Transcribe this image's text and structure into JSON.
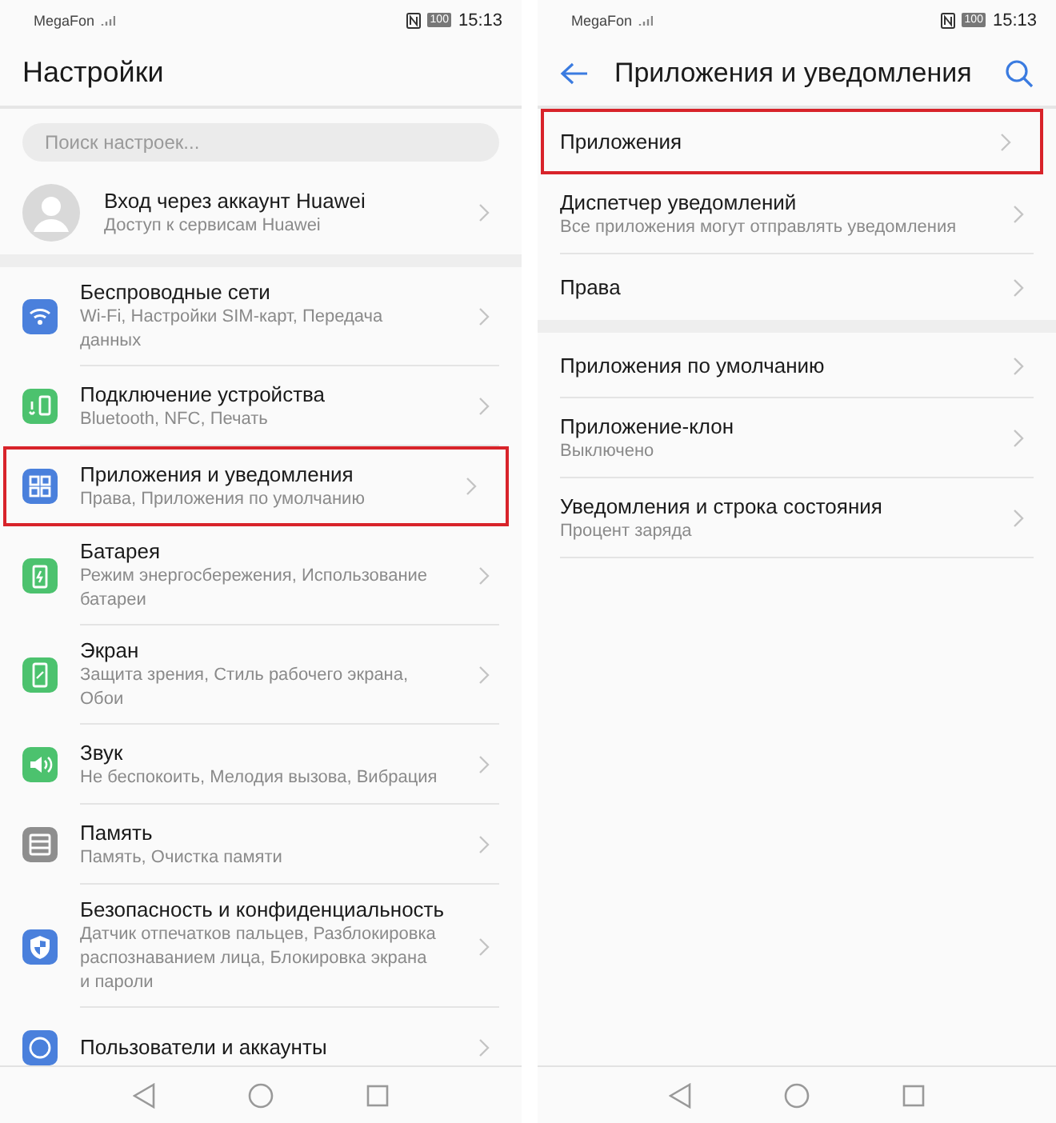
{
  "settings_screen": {
    "status_bar": {
      "carrier": "MegaFon",
      "battery": "100",
      "time": "15:13"
    },
    "header": {
      "title": "Настройки"
    },
    "search": {
      "placeholder": "Поиск настроек..."
    },
    "account": {
      "title": "Вход через аккаунт Huawei",
      "subtitle": "Доступ к сервисам Huawei"
    },
    "items": [
      {
        "title": "Беспроводные сети",
        "subtitle": "Wi-Fi, Настройки SIM-карт, Передача данных",
        "color": "#4a80dc",
        "highlighted": false
      },
      {
        "title": "Подключение устройства",
        "subtitle": "Bluetooth, NFC, Печать",
        "color": "#4cc26e",
        "highlighted": false
      },
      {
        "title": "Приложения и уведомления",
        "subtitle": "Права, Приложения по умолчанию",
        "color": "#4a80dc",
        "highlighted": true
      },
      {
        "title": "Батарея",
        "subtitle": "Режим энергосбережения, Использование батареи",
        "color": "#4cc26e",
        "highlighted": false
      },
      {
        "title": "Экран",
        "subtitle": "Защита зрения, Стиль рабочего экрана, Обои",
        "color": "#4cc26e",
        "highlighted": false
      },
      {
        "title": "Звук",
        "subtitle": "Не беспокоить, Мелодия вызова, Вибрация",
        "color": "#4cc26e",
        "highlighted": false
      },
      {
        "title": "Память",
        "subtitle": "Память, Очистка памяти",
        "color": "#8e8e8e",
        "highlighted": false
      },
      {
        "title": "Безопасность и конфиденциальность",
        "subtitle": "Датчик отпечатков пальцев, Разблокировка распознаванием лица, Блокировка экрана и пароли",
        "color": "#4a80dc",
        "highlighted": false
      },
      {
        "title": "Пользователи и аккаунты",
        "color": "#4a80dc",
        "highlighted": false
      }
    ]
  },
  "apps_screen": {
    "status_bar": {
      "carrier": "MegaFon",
      "battery": "100",
      "time": "15:13"
    },
    "header": {
      "title": "Приложения и уведомления"
    },
    "groups": [
      {
        "items": [
          {
            "title": "Приложения",
            "highlighted": true
          },
          {
            "title": "Диспетчер уведомлений",
            "subtitle": "Все приложения могут отправлять уведомления",
            "highlighted": false
          },
          {
            "title": "Права",
            "highlighted": false
          }
        ]
      },
      {
        "items": [
          {
            "title": "Приложения по умолчанию",
            "highlighted": false
          },
          {
            "title": "Приложение-клон",
            "subtitle": "Выключено",
            "highlighted": false
          },
          {
            "title": "Уведомления и строка состояния",
            "subtitle": "Процент заряда",
            "highlighted": false
          }
        ]
      }
    ]
  }
}
